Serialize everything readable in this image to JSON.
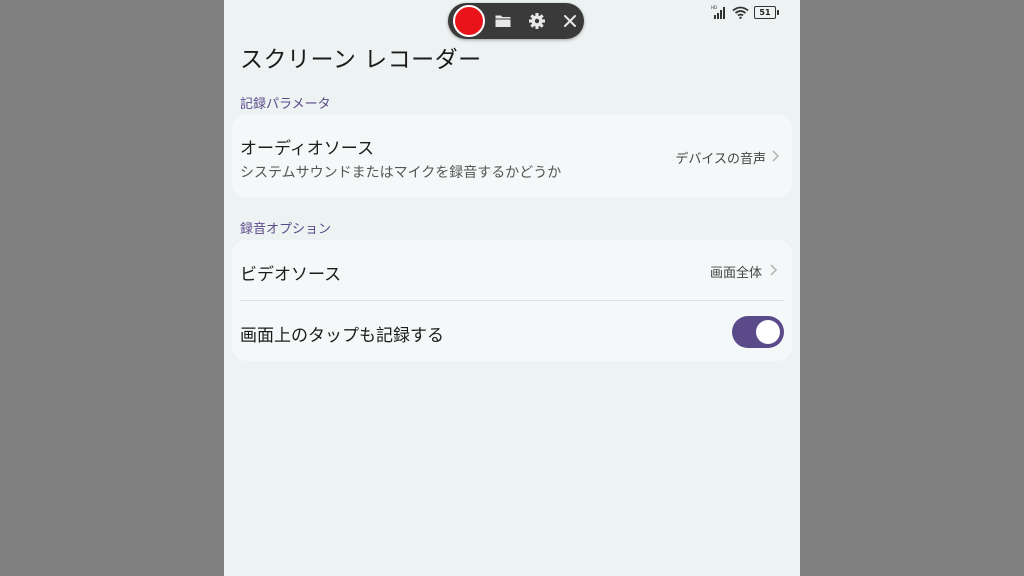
{
  "app": {
    "title": "スクリーン レコーダー"
  },
  "status_bar": {
    "network": "HD",
    "battery": "51",
    "icons": [
      "signal-icon",
      "wifi-icon",
      "battery-icon"
    ]
  },
  "recorder_bar": {
    "icons": [
      "record-button",
      "folder-icon",
      "gear-icon",
      "close-icon"
    ],
    "record_color": "#e8141a"
  },
  "sections": [
    {
      "label": "記録パラメータ",
      "rows": [
        {
          "title": "オーディオソース",
          "subtitle": "システムサウンドまたはマイクを録音するかどうか",
          "value": "デバイスの音声"
        }
      ]
    },
    {
      "label": "録音オプション",
      "rows": [
        {
          "title": "ビデオソース",
          "value": "画面全体"
        },
        {
          "title": "画面上のタップも記録する",
          "toggle": true
        }
      ]
    }
  ],
  "colors": {
    "accent": "#5b4a8a",
    "background": "#edf2f2",
    "card": "#f5f8f8"
  }
}
